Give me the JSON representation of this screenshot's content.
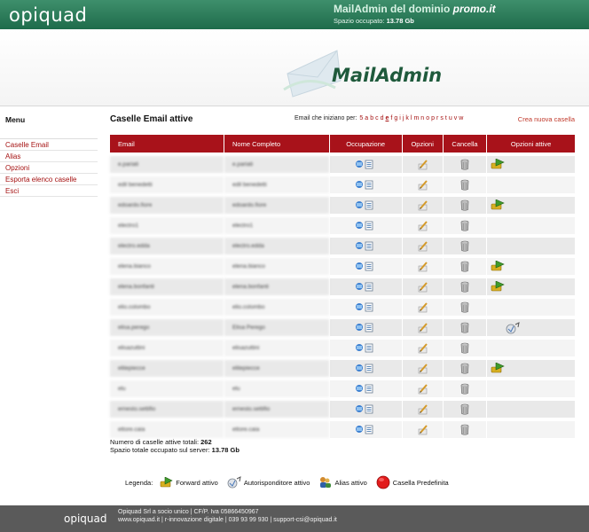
{
  "header": {
    "logo": "opiquad",
    "title_prefix": "MailAdmin del dominio ",
    "domain": "promo.it",
    "space_label": "Spazio occupato: ",
    "space_value": "13.78 Gb"
  },
  "banner": {
    "title": "MailAdmin"
  },
  "sidebar": {
    "title": "Menu",
    "items": [
      "Caselle Email",
      "Alias",
      "Opzioni",
      "Esporta elenco caselle",
      "Esci"
    ]
  },
  "main": {
    "title": "Caselle Email attive",
    "letters_label": "Email che iniziano per: ",
    "letters": [
      "5",
      "a",
      "b",
      "c",
      "d",
      "e",
      "f",
      "g",
      "i",
      "j",
      "k",
      "l",
      "m",
      "n",
      "o",
      "p",
      "r",
      "s",
      "t",
      "u",
      "v",
      "w"
    ],
    "current_letter": "e",
    "create_link": "Crea nuova casella",
    "columns": [
      "Email",
      "Nome Completo",
      "Occupazione",
      "Opzioni",
      "Cancella",
      "Opzioni attive"
    ],
    "rows": [
      {
        "email": "e.pariati",
        "name": "e.pariati",
        "active": "forward"
      },
      {
        "email": "edil benedetti",
        "name": "edil benedetti",
        "active": ""
      },
      {
        "email": "edoardo.fiore",
        "name": "edoardo.fiore",
        "active": "forward"
      },
      {
        "email": "electro1",
        "name": "electro1",
        "active": ""
      },
      {
        "email": "electro.edda",
        "name": "electro.edda",
        "active": ""
      },
      {
        "email": "elena.bianco",
        "name": "elena.bianco",
        "active": "forward"
      },
      {
        "email": "elena.bonfanti",
        "name": "elena.bonfanti",
        "active": "forward"
      },
      {
        "email": "elio.colombo",
        "name": "elio.colombo",
        "active": ""
      },
      {
        "email": "elisa.perego",
        "name": "Elisa Perego",
        "active": "autoresponder"
      },
      {
        "email": "elisazuttini",
        "name": "elisazuttini",
        "active": ""
      },
      {
        "email": "elitepiecce",
        "name": "elitepiecce",
        "active": "forward"
      },
      {
        "email": "elu",
        "name": "elu",
        "active": ""
      },
      {
        "email": "ernesto.settifio",
        "name": "ernesto.settifio",
        "active": ""
      },
      {
        "email": "ettore.caia",
        "name": "ettore.caia",
        "active": ""
      }
    ]
  },
  "stats": {
    "total_label": "Numero di caselle attive totali: ",
    "total_value": "262",
    "space_label": "Spazio totale occupato sul server: ",
    "space_value": "13.78 Gb"
  },
  "legend": {
    "label": "Legenda:",
    "forward": "Forward attivo",
    "autoresponder": "Autorisponditore attivo",
    "alias": "Alias attivo",
    "default": "Casella Predefinita"
  },
  "footer": {
    "logo": "opiquad",
    "line1": "Opiquad Srl a socio unico | CF/P. Iva 05866450967",
    "line2": "www.opiquad.it | r-innovazione digitale | 039 93 99 930 | support-csi@opiquad.it"
  },
  "colors": {
    "brand_green": "#1e6b4b",
    "header_red": "#a8121a",
    "link_red": "#a51212"
  }
}
